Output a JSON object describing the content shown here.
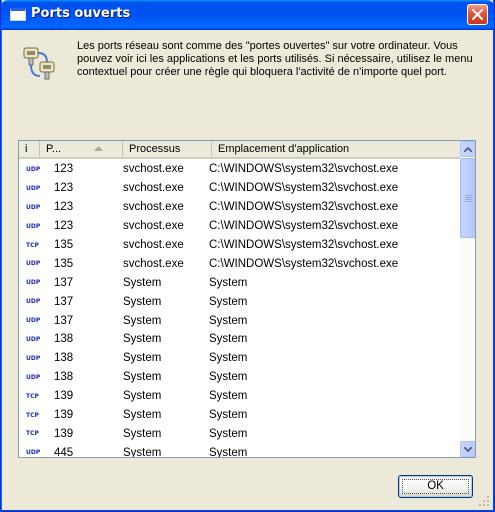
{
  "window": {
    "title": "Ports ouverts"
  },
  "info": {
    "text": "Les ports réseau sont comme des \"portes ouvertes\" sur votre ordinateur. Vous pouvez voir ici les applications et les ports utilisés. Si nécessaire, utilisez le menu contextuel pour créer une règle qui bloquera l'activité de n'importe quel port."
  },
  "table": {
    "columns": {
      "i": "i",
      "port": "P...",
      "process": "Processus",
      "location": "Emplacement d'application"
    },
    "rows": [
      {
        "proto": "UDP",
        "port": "123",
        "process": "svchost.exe",
        "location": "C:\\WINDOWS\\system32\\svchost.exe"
      },
      {
        "proto": "UDP",
        "port": "123",
        "process": "svchost.exe",
        "location": "C:\\WINDOWS\\system32\\svchost.exe"
      },
      {
        "proto": "UDP",
        "port": "123",
        "process": "svchost.exe",
        "location": "C:\\WINDOWS\\system32\\svchost.exe"
      },
      {
        "proto": "UDP",
        "port": "123",
        "process": "svchost.exe",
        "location": "C:\\WINDOWS\\system32\\svchost.exe"
      },
      {
        "proto": "TCP",
        "port": "135",
        "process": "svchost.exe",
        "location": "C:\\WINDOWS\\system32\\svchost.exe"
      },
      {
        "proto": "UDP",
        "port": "135",
        "process": "svchost.exe",
        "location": "C:\\WINDOWS\\system32\\svchost.exe"
      },
      {
        "proto": "UDP",
        "port": "137",
        "process": "System",
        "location": "System"
      },
      {
        "proto": "UDP",
        "port": "137",
        "process": "System",
        "location": "System"
      },
      {
        "proto": "UDP",
        "port": "137",
        "process": "System",
        "location": "System"
      },
      {
        "proto": "UDP",
        "port": "138",
        "process": "System",
        "location": "System"
      },
      {
        "proto": "UDP",
        "port": "138",
        "process": "System",
        "location": "System"
      },
      {
        "proto": "UDP",
        "port": "138",
        "process": "System",
        "location": "System"
      },
      {
        "proto": "TCP",
        "port": "139",
        "process": "System",
        "location": "System"
      },
      {
        "proto": "TCP",
        "port": "139",
        "process": "System",
        "location": "System"
      },
      {
        "proto": "TCP",
        "port": "139",
        "process": "System",
        "location": "System"
      },
      {
        "proto": "UDP",
        "port": "445",
        "process": "System",
        "location": "System"
      }
    ]
  },
  "buttons": {
    "ok": "OK"
  },
  "icons": {
    "title": "window-icon",
    "close": "close-icon",
    "info": "network-ports-icon",
    "sort": "sort-ascending-icon",
    "scroll_up": "chevron-up-icon",
    "scroll_down": "chevron-down-icon",
    "grip": "resize-grip-icon"
  },
  "colors": {
    "titlebar": "#0053ee",
    "close": "#e2583c",
    "protocol_text": "#1b2bb8",
    "dialog_bg": "#ece9d8"
  }
}
